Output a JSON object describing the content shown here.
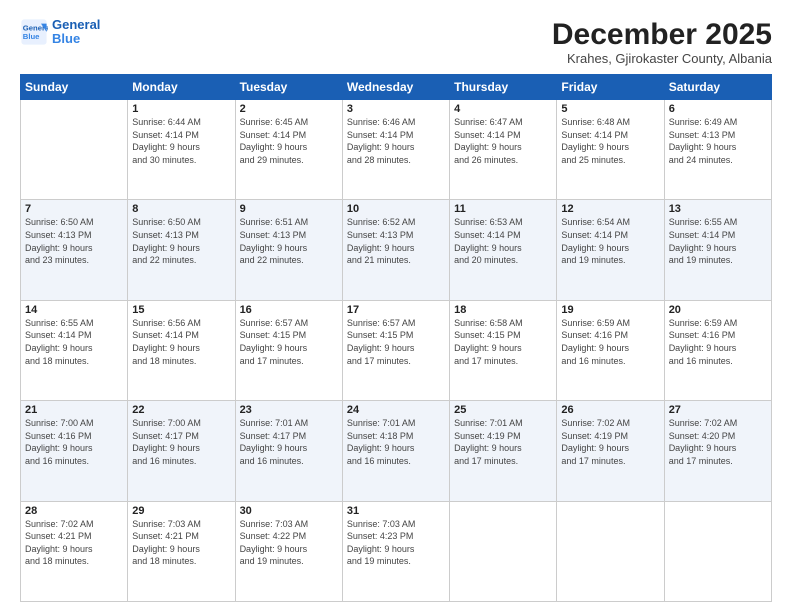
{
  "logo": {
    "line1": "General",
    "line2": "Blue"
  },
  "title": "December 2025",
  "subtitle": "Krahes, Gjirokaster County, Albania",
  "days_of_week": [
    "Sunday",
    "Monday",
    "Tuesday",
    "Wednesday",
    "Thursday",
    "Friday",
    "Saturday"
  ],
  "weeks": [
    [
      {
        "num": "",
        "info": ""
      },
      {
        "num": "1",
        "info": "Sunrise: 6:44 AM\nSunset: 4:14 PM\nDaylight: 9 hours\nand 30 minutes."
      },
      {
        "num": "2",
        "info": "Sunrise: 6:45 AM\nSunset: 4:14 PM\nDaylight: 9 hours\nand 29 minutes."
      },
      {
        "num": "3",
        "info": "Sunrise: 6:46 AM\nSunset: 4:14 PM\nDaylight: 9 hours\nand 28 minutes."
      },
      {
        "num": "4",
        "info": "Sunrise: 6:47 AM\nSunset: 4:14 PM\nDaylight: 9 hours\nand 26 minutes."
      },
      {
        "num": "5",
        "info": "Sunrise: 6:48 AM\nSunset: 4:14 PM\nDaylight: 9 hours\nand 25 minutes."
      },
      {
        "num": "6",
        "info": "Sunrise: 6:49 AM\nSunset: 4:13 PM\nDaylight: 9 hours\nand 24 minutes."
      }
    ],
    [
      {
        "num": "7",
        "info": "Sunrise: 6:50 AM\nSunset: 4:13 PM\nDaylight: 9 hours\nand 23 minutes."
      },
      {
        "num": "8",
        "info": "Sunrise: 6:50 AM\nSunset: 4:13 PM\nDaylight: 9 hours\nand 22 minutes."
      },
      {
        "num": "9",
        "info": "Sunrise: 6:51 AM\nSunset: 4:13 PM\nDaylight: 9 hours\nand 22 minutes."
      },
      {
        "num": "10",
        "info": "Sunrise: 6:52 AM\nSunset: 4:13 PM\nDaylight: 9 hours\nand 21 minutes."
      },
      {
        "num": "11",
        "info": "Sunrise: 6:53 AM\nSunset: 4:14 PM\nDaylight: 9 hours\nand 20 minutes."
      },
      {
        "num": "12",
        "info": "Sunrise: 6:54 AM\nSunset: 4:14 PM\nDaylight: 9 hours\nand 19 minutes."
      },
      {
        "num": "13",
        "info": "Sunrise: 6:55 AM\nSunset: 4:14 PM\nDaylight: 9 hours\nand 19 minutes."
      }
    ],
    [
      {
        "num": "14",
        "info": "Sunrise: 6:55 AM\nSunset: 4:14 PM\nDaylight: 9 hours\nand 18 minutes."
      },
      {
        "num": "15",
        "info": "Sunrise: 6:56 AM\nSunset: 4:14 PM\nDaylight: 9 hours\nand 18 minutes."
      },
      {
        "num": "16",
        "info": "Sunrise: 6:57 AM\nSunset: 4:15 PM\nDaylight: 9 hours\nand 17 minutes."
      },
      {
        "num": "17",
        "info": "Sunrise: 6:57 AM\nSunset: 4:15 PM\nDaylight: 9 hours\nand 17 minutes."
      },
      {
        "num": "18",
        "info": "Sunrise: 6:58 AM\nSunset: 4:15 PM\nDaylight: 9 hours\nand 17 minutes."
      },
      {
        "num": "19",
        "info": "Sunrise: 6:59 AM\nSunset: 4:16 PM\nDaylight: 9 hours\nand 16 minutes."
      },
      {
        "num": "20",
        "info": "Sunrise: 6:59 AM\nSunset: 4:16 PM\nDaylight: 9 hours\nand 16 minutes."
      }
    ],
    [
      {
        "num": "21",
        "info": "Sunrise: 7:00 AM\nSunset: 4:16 PM\nDaylight: 9 hours\nand 16 minutes."
      },
      {
        "num": "22",
        "info": "Sunrise: 7:00 AM\nSunset: 4:17 PM\nDaylight: 9 hours\nand 16 minutes."
      },
      {
        "num": "23",
        "info": "Sunrise: 7:01 AM\nSunset: 4:17 PM\nDaylight: 9 hours\nand 16 minutes."
      },
      {
        "num": "24",
        "info": "Sunrise: 7:01 AM\nSunset: 4:18 PM\nDaylight: 9 hours\nand 16 minutes."
      },
      {
        "num": "25",
        "info": "Sunrise: 7:01 AM\nSunset: 4:19 PM\nDaylight: 9 hours\nand 17 minutes."
      },
      {
        "num": "26",
        "info": "Sunrise: 7:02 AM\nSunset: 4:19 PM\nDaylight: 9 hours\nand 17 minutes."
      },
      {
        "num": "27",
        "info": "Sunrise: 7:02 AM\nSunset: 4:20 PM\nDaylight: 9 hours\nand 17 minutes."
      }
    ],
    [
      {
        "num": "28",
        "info": "Sunrise: 7:02 AM\nSunset: 4:21 PM\nDaylight: 9 hours\nand 18 minutes."
      },
      {
        "num": "29",
        "info": "Sunrise: 7:03 AM\nSunset: 4:21 PM\nDaylight: 9 hours\nand 18 minutes."
      },
      {
        "num": "30",
        "info": "Sunrise: 7:03 AM\nSunset: 4:22 PM\nDaylight: 9 hours\nand 19 minutes."
      },
      {
        "num": "31",
        "info": "Sunrise: 7:03 AM\nSunset: 4:23 PM\nDaylight: 9 hours\nand 19 minutes."
      },
      {
        "num": "",
        "info": ""
      },
      {
        "num": "",
        "info": ""
      },
      {
        "num": "",
        "info": ""
      }
    ]
  ]
}
